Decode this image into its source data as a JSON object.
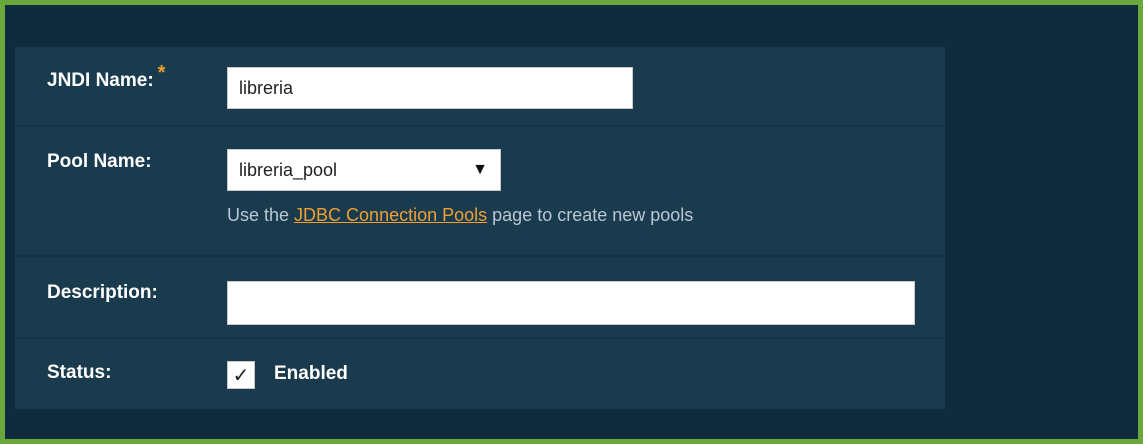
{
  "form": {
    "jndi": {
      "label": "JNDI Name:",
      "required_mark": "*",
      "value": "libreria"
    },
    "pool": {
      "label": "Pool Name:",
      "selected": "libreria_pool",
      "help_prefix": "Use the ",
      "help_link": "JDBC Connection Pools",
      "help_suffix": " page to create new pools"
    },
    "description": {
      "label": "Description:",
      "value": ""
    },
    "status": {
      "label": "Status:",
      "checkbox_mark": "✓",
      "checkbox_checked": true,
      "checkbox_label": "Enabled"
    }
  },
  "colors": {
    "background": "#0f2b3d",
    "panel": "#1a3a4d",
    "accent": "#f0a030",
    "border": "#6aa83c"
  },
  "icons": {
    "dropdown": "triangle-down-icon",
    "required": "asterisk-icon",
    "checkbox": "checkmark-icon"
  }
}
